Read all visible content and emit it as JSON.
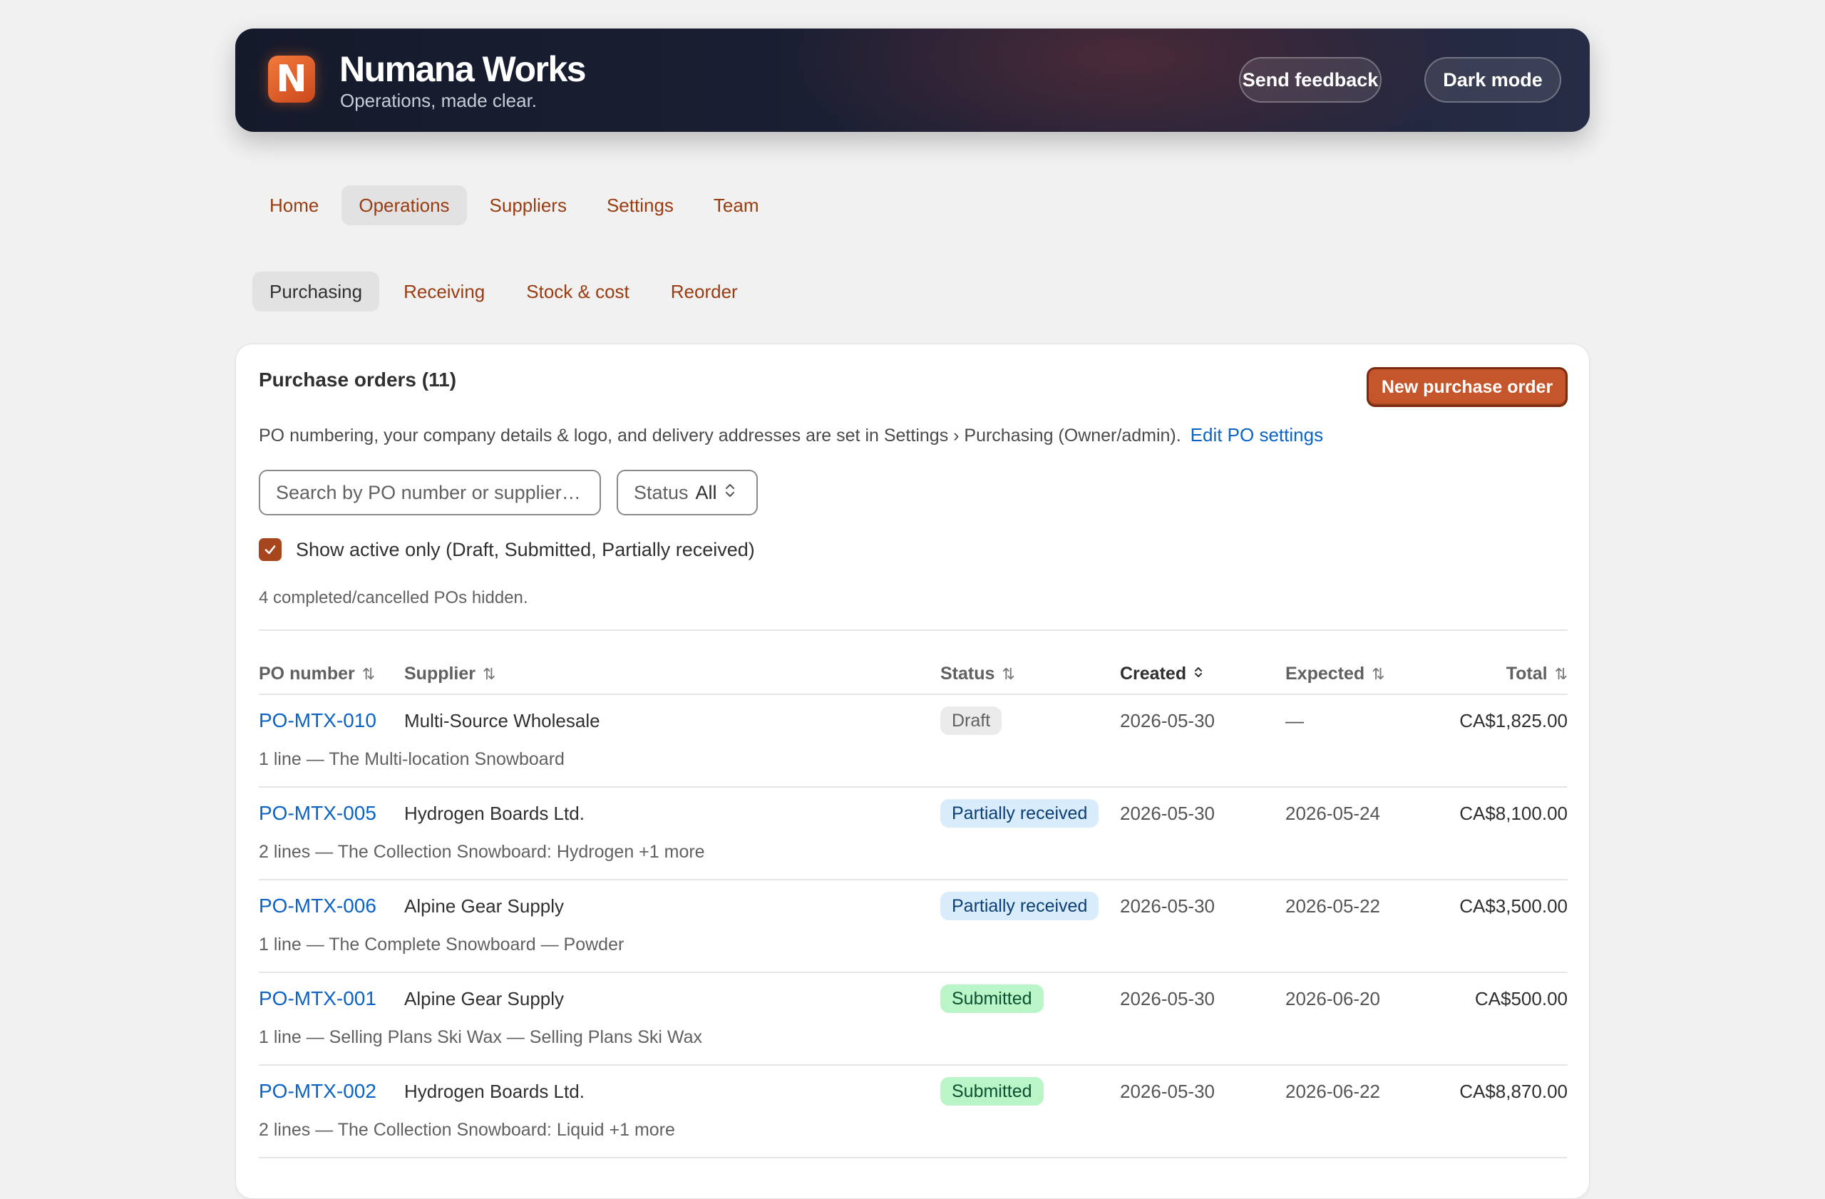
{
  "app": {
    "name": "Numana Works",
    "tagline": "Operations, made clear.",
    "logo_letter": "N",
    "accent": "#c5552a"
  },
  "header_buttons": {
    "feedback": "Send feedback",
    "dark_mode": "Dark mode"
  },
  "nav": {
    "items": [
      "Home",
      "Operations",
      "Suppliers",
      "Settings",
      "Team"
    ],
    "active": "Operations"
  },
  "subnav": {
    "items": [
      "Purchasing",
      "Receiving",
      "Stock & cost",
      "Reorder"
    ],
    "active": "Purchasing"
  },
  "card": {
    "title": "Purchase orders (11)",
    "new_button": "New purchase order",
    "info_text": "PO numbering, your company details & logo, and delivery addresses are set in Settings › Purchasing (Owner/admin).",
    "info_link": "Edit PO settings",
    "search_placeholder": "Search by PO number or supplier…",
    "status_label": "Status",
    "status_value": "All",
    "active_only_label": "Show active only (Draft, Submitted, Partially received)",
    "active_only_checked": true,
    "hidden_note": "4 completed/cancelled POs hidden."
  },
  "table": {
    "columns": {
      "po": "PO number",
      "supplier": "Supplier",
      "status": "Status",
      "created": "Created",
      "expected": "Expected",
      "total": "Total"
    },
    "sorted_by": "Created",
    "rows": [
      {
        "po": "PO-MTX-010",
        "supplier": "Multi-Source Wholesale",
        "status": "Draft",
        "status_kind": "draft",
        "created": "2026-05-30",
        "expected": "—",
        "total": "CA$1,825.00",
        "desc": "1 line — The Multi-location Snowboard"
      },
      {
        "po": "PO-MTX-005",
        "supplier": "Hydrogen Boards Ltd.",
        "status": "Partially received",
        "status_kind": "partial",
        "created": "2026-05-30",
        "expected": "2026-05-24",
        "total": "CA$8,100.00",
        "desc": "2 lines — The Collection Snowboard: Hydrogen +1 more"
      },
      {
        "po": "PO-MTX-006",
        "supplier": "Alpine Gear Supply",
        "status": "Partially received",
        "status_kind": "partial",
        "created": "2026-05-30",
        "expected": "2026-05-22",
        "total": "CA$3,500.00",
        "desc": "1 line — The Complete Snowboard — Powder"
      },
      {
        "po": "PO-MTX-001",
        "supplier": "Alpine Gear Supply",
        "status": "Submitted",
        "status_kind": "submitted",
        "created": "2026-05-30",
        "expected": "2026-06-20",
        "total": "CA$500.00",
        "desc": "1 line — Selling Plans Ski Wax — Selling Plans Ski Wax"
      },
      {
        "po": "PO-MTX-002",
        "supplier": "Hydrogen Boards Ltd.",
        "status": "Submitted",
        "status_kind": "submitted",
        "created": "2026-05-30",
        "expected": "2026-06-22",
        "total": "CA$8,870.00",
        "desc": "2 lines — The Collection Snowboard: Liquid +1 more"
      }
    ]
  },
  "status_colors": {
    "draft": "#ebebeb",
    "partial": "#d9ecfb",
    "submitted": "#baf5c7"
  }
}
